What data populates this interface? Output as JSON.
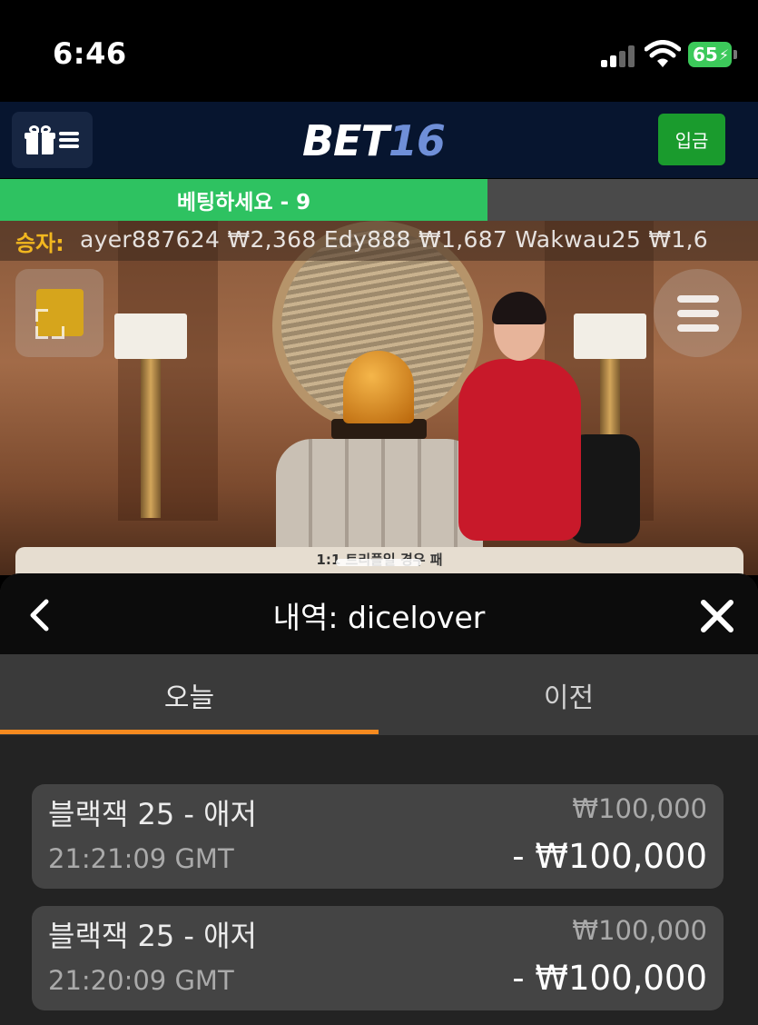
{
  "status_bar": {
    "time": "6:46",
    "battery": "65"
  },
  "header": {
    "logo_part1": "BET",
    "logo_part2": "16",
    "deposit_label": "입금"
  },
  "round": {
    "label": "베팅하세요 - 9",
    "progress": 0.643
  },
  "ticker": {
    "label": "승자:",
    "text": "ayer887624   ₩2,368 Edy888   ₩1,687 Wakwau25   ₩1,6"
  },
  "bet_panel": {
    "label": "1:1 트리플일 경우 패"
  },
  "history": {
    "title": "내역: dicelover",
    "tabs": [
      {
        "label": "오늘",
        "active": true
      },
      {
        "label": "이전",
        "active": false
      }
    ],
    "items": [
      {
        "game": "블랙잭 25 - 애저",
        "time": "21:21:09 GMT",
        "bet": "₩100,000",
        "result": "- ₩100,000"
      },
      {
        "game": "블랙잭 25 - 애저",
        "time": "21:20:09 GMT",
        "bet": "₩100,000",
        "result": "- ₩100,000"
      }
    ]
  },
  "colors": {
    "header_bg": "#07152f",
    "deposit_green": "#1a9b2d",
    "progress_green": "#2ec261",
    "tab_accent": "#f58a1f",
    "ticker_label": "#f2b71f"
  },
  "icons": [
    "gift-icon",
    "menu-icon",
    "fullscreen-icon",
    "hamburger-menu-icon",
    "back-chevron-icon",
    "close-icon",
    "wifi-icon",
    "signal-icon",
    "battery-icon"
  ]
}
